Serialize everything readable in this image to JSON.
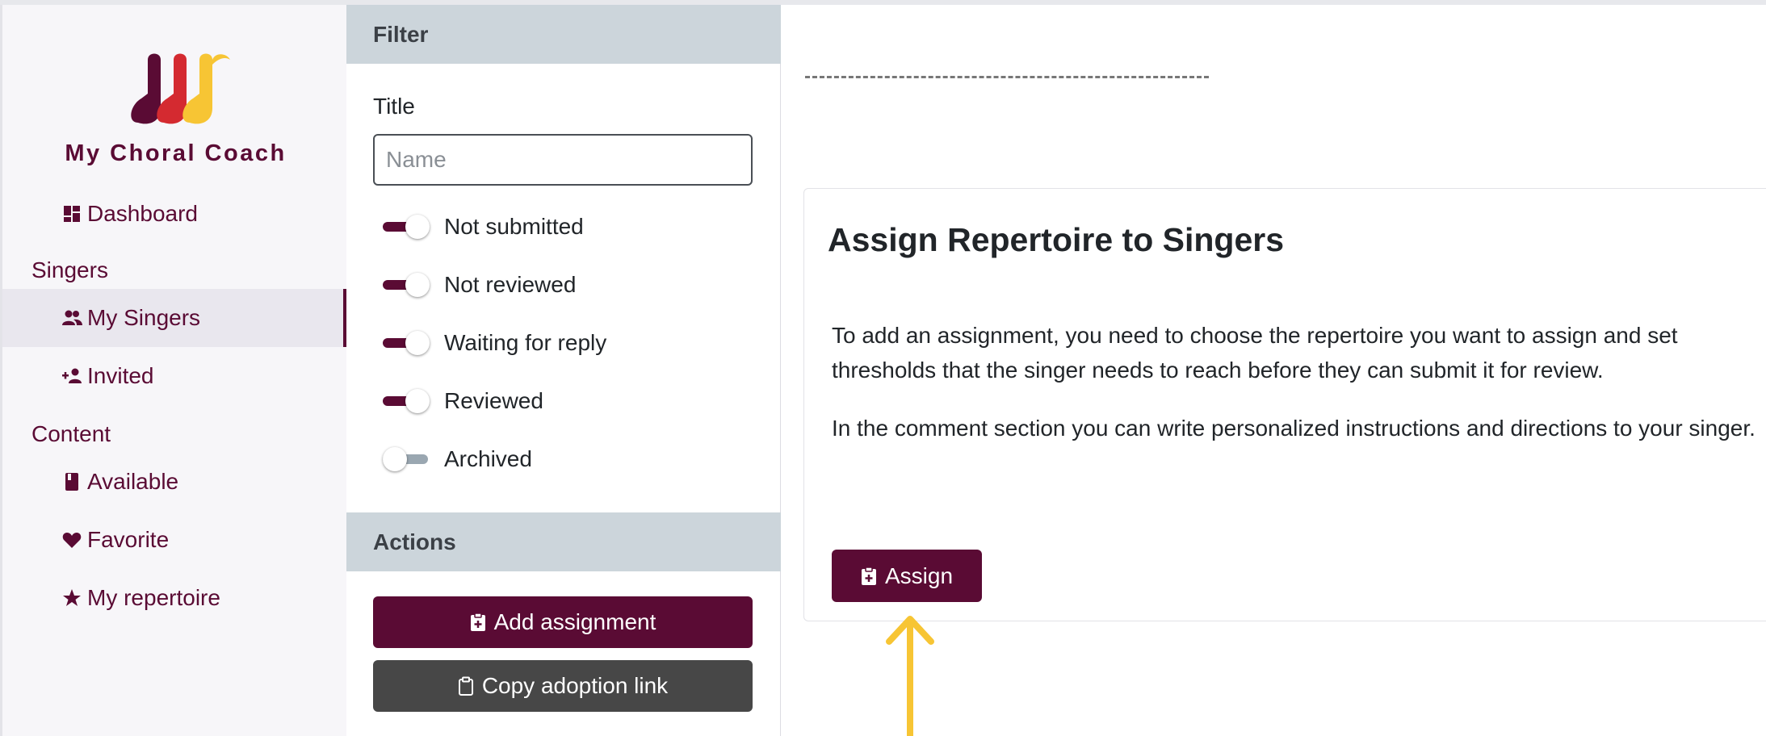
{
  "app": {
    "name": "My Choral Coach",
    "brand_colors": [
      "#5a0b34",
      "#d42a30",
      "#f7c534"
    ]
  },
  "sidebar": {
    "items_top": [
      {
        "label": "Dashboard",
        "icon": "dashboard-icon"
      }
    ],
    "sections": [
      {
        "label": "Singers",
        "items": [
          {
            "label": "My Singers",
            "icon": "people-icon",
            "active": true
          },
          {
            "label": "Invited",
            "icon": "person-add-icon",
            "active": false
          }
        ]
      },
      {
        "label": "Content",
        "items": [
          {
            "label": "Available",
            "icon": "book-icon",
            "active": false
          },
          {
            "label": "Favorite",
            "icon": "heart-icon",
            "active": false
          },
          {
            "label": "My repertoire",
            "icon": "star-icon",
            "active": false
          }
        ]
      }
    ]
  },
  "filter": {
    "header": "Filter",
    "title_label": "Title",
    "name_placeholder": "Name",
    "name_value": "",
    "toggles": [
      {
        "label": "Not submitted",
        "on": true
      },
      {
        "label": "Not reviewed",
        "on": true
      },
      {
        "label": "Waiting for reply",
        "on": true
      },
      {
        "label": "Reviewed",
        "on": true
      },
      {
        "label": "Archived",
        "on": false
      }
    ]
  },
  "actions": {
    "header": "Actions",
    "add_assignment": "Add assignment",
    "copy_adoption_link": "Copy adoption link"
  },
  "card": {
    "title": "Assign Repertoire to Singers",
    "paragraph1": "To add an assignment, you need to choose the repertoire you want to assign and set thresholds that the singer needs to reach before they can submit it for review.",
    "paragraph2": "In the comment section you can write personalized instructions and directions to your singer.",
    "assign_label": "Assign"
  },
  "colors": {
    "accent": "#5a0b34",
    "dark_button": "#474747",
    "panel_header": "#ccd5db",
    "arrow": "#f7c534"
  }
}
